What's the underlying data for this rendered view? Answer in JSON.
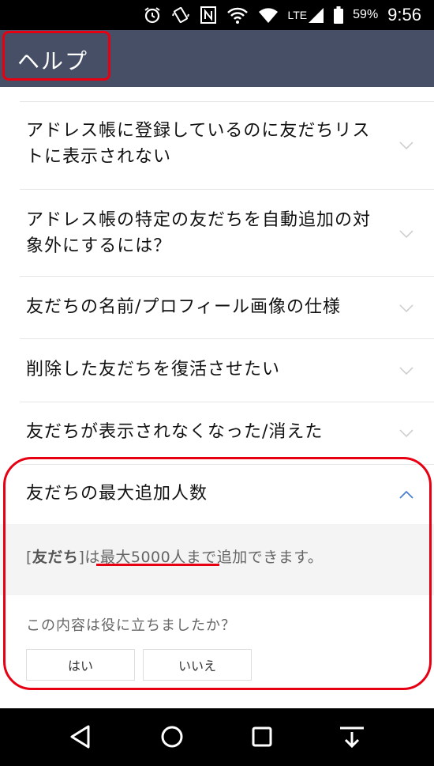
{
  "status_bar": {
    "icons": [
      "alarm-icon",
      "vibrate-icon",
      "nfc-icon",
      "wifi-calling-icon",
      "wifi-icon",
      "lte-signal-icon",
      "battery-icon"
    ],
    "lte_label": "LTE",
    "battery_percent": "59%",
    "time": "9:56"
  },
  "app_bar": {
    "title": "ヘルプ"
  },
  "faq": {
    "items": [
      {
        "label": "アドレス帳に登録しているのに友だちリストに表示されない"
      },
      {
        "label": "アドレス帳の特定の友だちを自動追加の対象外にするには？"
      },
      {
        "label": "友だちの名前/プロフィール画像の仕様"
      },
      {
        "label": "削除した友だちを復活させたい"
      },
      {
        "label": "友だちが表示されなくなった/消えた"
      },
      {
        "label": "友だちの最大追加人数"
      }
    ],
    "expanded_index": 5,
    "answer": {
      "bracket_open": "[",
      "term": "友だち",
      "bracket_close": "]は",
      "highlighted": "最大5000人まで追加",
      "rest": "できます。"
    }
  },
  "feedback": {
    "question": "この内容は役に立ちましたか？",
    "yes_label": "はい",
    "no_label": "いいえ"
  },
  "nav_bar": {
    "buttons": [
      "back-icon",
      "home-icon",
      "recents-icon",
      "notification-pulldown-icon"
    ]
  },
  "colors": {
    "app_bar": "#474f66",
    "annotation_red": "#e60012",
    "chevron_active": "#4a7fd4"
  }
}
